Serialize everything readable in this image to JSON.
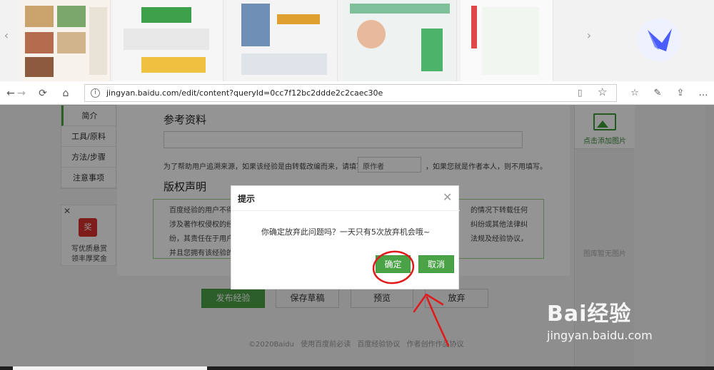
{
  "browser": {
    "url": "jingyan.baidu.com/edit/content?queryId=0cc7f12bc2ddde2c2caec30e"
  },
  "sidebar": {
    "items": [
      {
        "label": "简介"
      },
      {
        "label": "工具/原料"
      },
      {
        "label": "方法/步骤"
      },
      {
        "label": "注意事项"
      }
    ]
  },
  "promo": {
    "badge": "奖",
    "line1": "写优质悬赏",
    "line2": "领丰厚奖金"
  },
  "reference": {
    "title": "参考资料",
    "hint_before": "为了帮助用户追溯来源，如果该经验是由转载改编而来，请填写",
    "author_placeholder": "原作者",
    "hint_after": "，如果您就是作者本人，则不用填写。"
  },
  "copyright": {
    "title": "版权声明",
    "line1_left": "百度经验的用户不得",
    "line1_right": "的情况下转载任何",
    "line2_left": "涉及著作权侵权的经",
    "line2_right": "纠纷或其他法律纠",
    "line3_left": "纷，其责任在于用户",
    "line3_right": "法规及经验协议，",
    "line4_left": "并且您拥有该经验的"
  },
  "right_panel": {
    "add_image": "点击添加图片",
    "no_image": "图库暂无图片"
  },
  "actions": {
    "publish": "发布经验",
    "save": "保存草稿",
    "preview": "预览",
    "abandon": "放弃"
  },
  "footer": {
    "copyright": "©2020Baidu",
    "links": [
      "使用百度前必读",
      "百度经验协议",
      "作者创作作品协议"
    ]
  },
  "dialog": {
    "title": "提示",
    "message": "你确定放弃此问题吗？一天只有5次放弃机会哦~",
    "ok": "确定",
    "cancel": "取消"
  },
  "watermark": {
    "brand": "Bai经验",
    "site": "jingyan.baidu.com"
  },
  "colors": {
    "accent_green": "#4aa346",
    "annotation_red": "#e0191b"
  }
}
